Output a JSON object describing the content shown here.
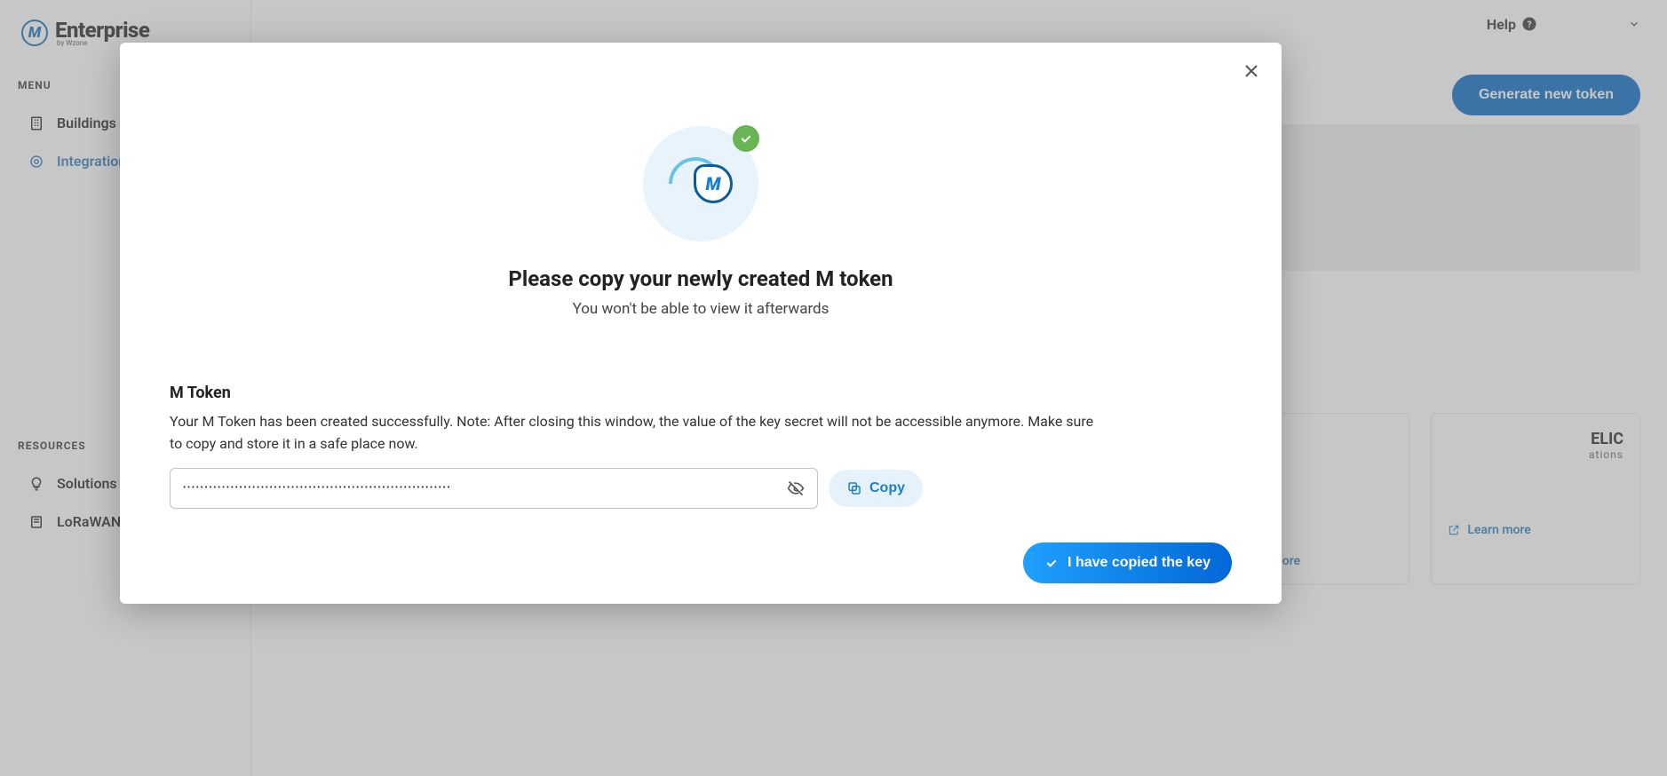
{
  "brand": {
    "name": "Enterprise",
    "sub": "by Wzone",
    "badge": "M"
  },
  "sidebar": {
    "menu_label": "MENU",
    "resources_label": "RESOURCES",
    "items": [
      {
        "label": "Buildings"
      },
      {
        "label": "Integrations"
      }
    ],
    "resources": [
      {
        "label": "Solutions"
      },
      {
        "label": "LoRaWAN Resources"
      }
    ]
  },
  "topbar": {
    "help": "Help"
  },
  "header": {
    "generate_btn": "Generate new token"
  },
  "cards": {
    "card5_title": "ELIC",
    "card5_sub": "ations",
    "learn_more": "Learn more"
  },
  "modal": {
    "title": "Please copy your newly created M token",
    "subtitle": "You won't be able to view it afterwards",
    "token_label": "M Token",
    "token_desc": "Your M Token has been created successfully. Note: After closing this window, the value of the key secret will not be accessible anymore. Make sure to copy and store it in a safe place now.",
    "token_value": "••••••••••••••••••••••••••••••••••••••••••••••••••••••••••••••",
    "copy_label": "Copy",
    "confirm_label": "I have copied the key"
  }
}
